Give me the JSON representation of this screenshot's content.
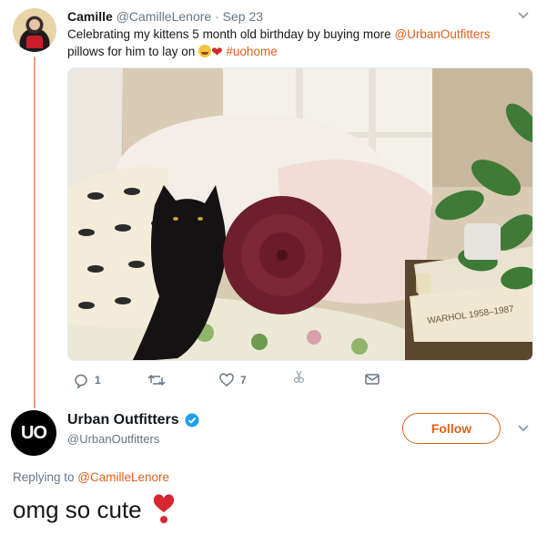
{
  "tweet1": {
    "name": "Camille",
    "handle": "@CamilleLenore",
    "separator": "·",
    "date": "Sep 23",
    "text_a": "Celebrating my kittens 5 month old birthday by buying more ",
    "mention": "@UrbanOutfitters",
    "text_b": "pillows for him to lay on ",
    "hashtag": "#uohome",
    "photo_desc_icon": "cat-photo",
    "book_spine_text": "WARHOL 1958–1987",
    "actions": {
      "reply_count": "1",
      "retweet_count": "",
      "like_count": "7"
    }
  },
  "tweet2": {
    "avatar_text": "UO",
    "name": "Urban Outfitters",
    "handle": "@UrbanOutfitters",
    "follow_label": "Follow",
    "replying_prefix": "Replying to ",
    "replying_handle": "@CamilleLenore",
    "text": "omg so cute"
  },
  "colors": {
    "accent": "#e0601a",
    "thread_line": "#f0a173",
    "verified": "#1da1f2",
    "heart": "#d7262e",
    "muted": "#657786"
  }
}
